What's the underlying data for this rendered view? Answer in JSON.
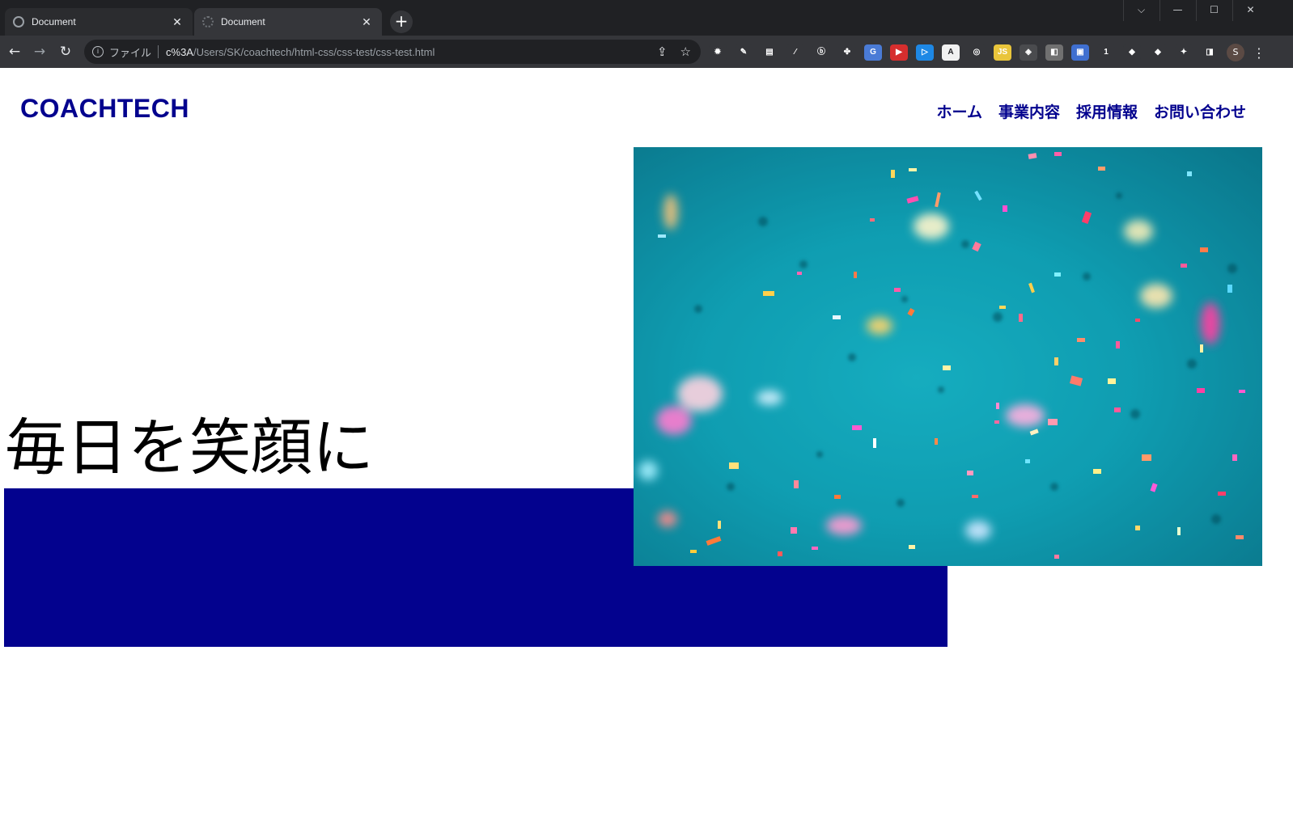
{
  "browser": {
    "tabs": [
      {
        "title": "Document",
        "active": false
      },
      {
        "title": "Document",
        "active": true
      }
    ],
    "new_tab_label": "+",
    "window_controls": [
      "⌵",
      "—",
      "☐",
      "✕"
    ],
    "nav": {
      "back": "←",
      "forward": "→",
      "reload": "↻"
    },
    "address": {
      "info_icon": "i",
      "scheme_label": "ファイル",
      "host": "c%3A",
      "path": "/Users/SK/coachtech/html-css/css-test/css-test.html",
      "share_icon": "⇪",
      "star_icon": "☆"
    },
    "extensions": [
      {
        "name": "gear-ext-icon",
        "glyph": "✹",
        "bg": "#35363a"
      },
      {
        "name": "note-ext-icon",
        "glyph": "✎",
        "bg": "#35363a"
      },
      {
        "name": "table-ext-icon",
        "glyph": "▤",
        "bg": "#35363a"
      },
      {
        "name": "pen-ext-icon",
        "glyph": "⁄",
        "bg": "#35363a"
      },
      {
        "name": "circle-b-ext-icon",
        "glyph": "ⓑ",
        "bg": "#35363a"
      },
      {
        "name": "puzzle-green-ext-icon",
        "glyph": "✤",
        "bg": "#35363a"
      },
      {
        "name": "translate-ext-icon",
        "glyph": "G",
        "bg": "#4a7bd6"
      },
      {
        "name": "youtube-ext-icon",
        "glyph": "▶",
        "bg": "#d62e2e"
      },
      {
        "name": "play-blue-ext-icon",
        "glyph": "▷",
        "bg": "#1e88e5"
      },
      {
        "name": "a-logo-ext-icon",
        "glyph": "A",
        "bg": "#f1f1f1"
      },
      {
        "name": "ring-ext-icon",
        "glyph": "◎",
        "bg": "#35363a"
      },
      {
        "name": "js-ext-icon",
        "glyph": "JS",
        "bg": "#e9c53b"
      },
      {
        "name": "shield-ext-icon",
        "glyph": "◈",
        "bg": "#4a4b4e"
      },
      {
        "name": "portrait-ext-icon",
        "glyph": "◧",
        "bg": "#707070"
      },
      {
        "name": "window-ext-icon",
        "glyph": "▣",
        "bg": "#3f6fd0"
      },
      {
        "name": "number-ext-icon",
        "glyph": "1",
        "bg": "#35363a"
      },
      {
        "name": "cube-ext-icon",
        "glyph": "◆",
        "bg": "#35363a"
      },
      {
        "name": "diamond-ext-icon",
        "glyph": "◆",
        "bg": "#35363a"
      },
      {
        "name": "puzzle-ext-icon",
        "glyph": "✦",
        "bg": "#35363a"
      },
      {
        "name": "sidepanel-ext-icon",
        "glyph": "◨",
        "bg": "#35363a"
      }
    ],
    "profile_initial": "S",
    "menu_icon": "⋮"
  },
  "site": {
    "logo": "COACHTECH",
    "nav": [
      "ホーム",
      "事業内容",
      "採用情報",
      "お問い合わせ"
    ],
    "headline": "毎日を笑顔に",
    "brand_color": "#03028e"
  },
  "hero_image": {
    "subject": "confetti falling against teal background",
    "base_color": "#0f9fb3"
  }
}
